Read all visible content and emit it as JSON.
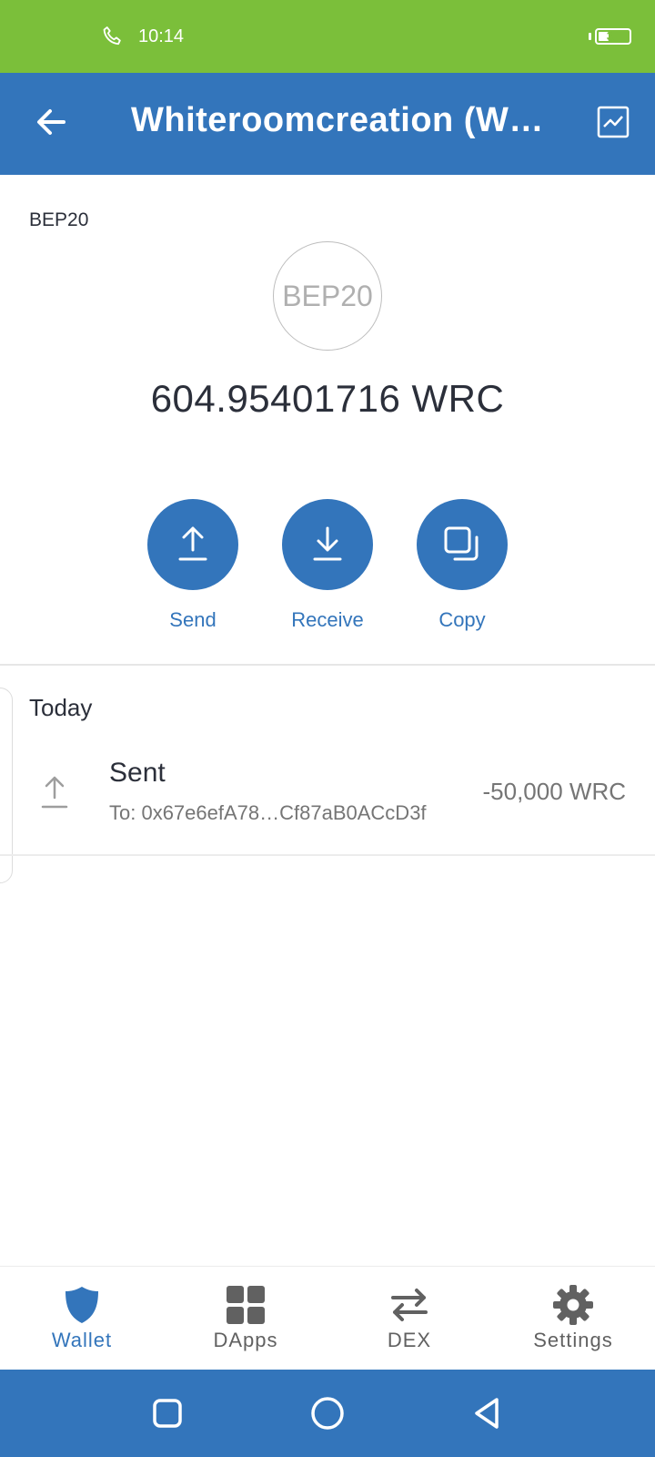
{
  "status_bar": {
    "time": "10:14",
    "battery": "31",
    "battery_fraction": 0.31,
    "icons": [
      "phone-icon",
      "battery-icon"
    ]
  },
  "app_bar": {
    "title": "Whiteroomcreation (W…",
    "icons": [
      "back-arrow-icon",
      "price-chart-icon"
    ]
  },
  "token": {
    "network": "BEP20",
    "logo_text": "BEP20",
    "balance": "604.95401716 WRC"
  },
  "actions": [
    {
      "label": "Send",
      "icon": "upload-arrow-icon"
    },
    {
      "label": "Receive",
      "icon": "download-arrow-icon"
    },
    {
      "label": "Copy",
      "icon": "copy-icon"
    }
  ],
  "transactions": {
    "section": "Today",
    "items": [
      {
        "title": "Sent",
        "to": "To: 0x67e6efA78…Cf87aB0ACcD3f",
        "amount": "-50,000 WRC",
        "icon": "sent-arrow-icon"
      }
    ]
  },
  "bottom_nav": [
    {
      "label": "Wallet",
      "icon": "shield-icon",
      "active": true
    },
    {
      "label": "DApps",
      "icon": "grid-icon",
      "active": false
    },
    {
      "label": "DEX",
      "icon": "swap-arrows-icon",
      "active": false
    },
    {
      "label": "Settings",
      "icon": "gear-icon",
      "active": false
    }
  ],
  "system_nav": [
    "recents-square-icon",
    "home-circle-icon",
    "back-triangle-icon"
  ],
  "colors": {
    "status_bar": "#7bbf3a",
    "primary": "#3375bb",
    "text": "#2b2f3a",
    "muted": "#757575"
  }
}
